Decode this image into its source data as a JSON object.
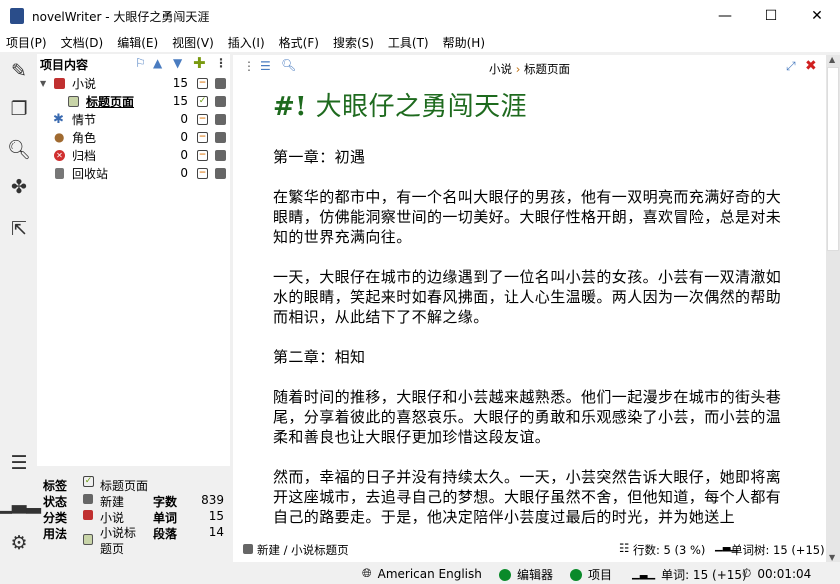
{
  "window": {
    "title": "novelWriter - 大眼仔之勇闯天涯",
    "min": "—",
    "max": "☐",
    "close": "✕"
  },
  "menu": [
    "项目(P)",
    "文档(D)",
    "编辑(E)",
    "视图(V)",
    "插入(I)",
    "格式(F)",
    "搜索(S)",
    "工具(T)",
    "帮助(H)"
  ],
  "tree": {
    "header": "项目内容",
    "items": [
      {
        "label": "小说",
        "count": "15",
        "icon": "novel-root-icon",
        "color": "#c03030"
      },
      {
        "label": "标题页面",
        "count": "15",
        "icon": "document-icon",
        "color": "#8aa070",
        "active": true
      },
      {
        "label": "情节",
        "count": "0",
        "icon": "plot-icon",
        "color": "#3a6ab0"
      },
      {
        "label": "角色",
        "count": "0",
        "icon": "character-icon",
        "color": "#a06a30"
      },
      {
        "label": "归档",
        "count": "0",
        "icon": "archive-icon",
        "color": "#d03030"
      },
      {
        "label": "回收站",
        "count": "0",
        "icon": "trash-icon",
        "color": "#666666"
      }
    ]
  },
  "details": {
    "label_tag": "标签",
    "tag": "标题页面",
    "label_status": "状态",
    "status": "新建",
    "label_class": "分类",
    "class": "小说",
    "label_usage": "用法",
    "usage": "小说标题页",
    "label_chars": "字数",
    "chars": "839",
    "label_words": "单词",
    "words": "15",
    "label_paras": "段落",
    "paras": "14"
  },
  "editor": {
    "breadcrumb_a": "小说",
    "breadcrumb_sep": "›",
    "breadcrumb_b": "标题页面",
    "heading_mark": "#!",
    "heading": "大眼仔之勇闯天涯",
    "paragraphs": [
      "第一章：初遇",
      "在繁华的都市中，有一个名叫大眼仔的男孩，他有一双明亮而充满好奇的大眼睛，仿佛能洞察世间的一切美好。大眼仔性格开朗，喜欢冒险，总是对未知的世界充满向往。",
      "一天，大眼仔在城市的边缘遇到了一位名叫小芸的女孩。小芸有一双清澈如水的眼睛，笑起来时如春风拂面，让人心生温暖。两人因为一次偶然的帮助而相识，从此结下了不解之缘。",
      "第二章：相知",
      "随着时间的推移，大眼仔和小芸越来越熟悉。他们一起漫步在城市的街头巷尾，分享着彼此的喜怒哀乐。大眼仔的勇敢和乐观感染了小芸，而小芸的温柔和善良也让大眼仔更加珍惜这段友谊。",
      "然而，幸福的日子并没有持续太久。一天，小芸突然告诉大眼仔，她即将离开这座城市，去追寻自己的梦想。大眼仔虽然不舍，但他知道，每个人都有自己的路要走。于是，他决定陪伴小芸度过最后的时光，并为她送上"
    ],
    "footer_status": "新建 / 小说标题页",
    "footer_lines": "行数: 5 (3 %)",
    "footer_words": "单词树: 15 (+15)"
  },
  "scroll": {
    "position_fraction": 0.0,
    "visible_fraction": 0.38
  },
  "status": {
    "language": "American English",
    "editor": "编辑器",
    "project": "项目",
    "words": "单词: 15 (+15)",
    "time": "00:01:04",
    "ok_color": "#0a8a2a"
  }
}
